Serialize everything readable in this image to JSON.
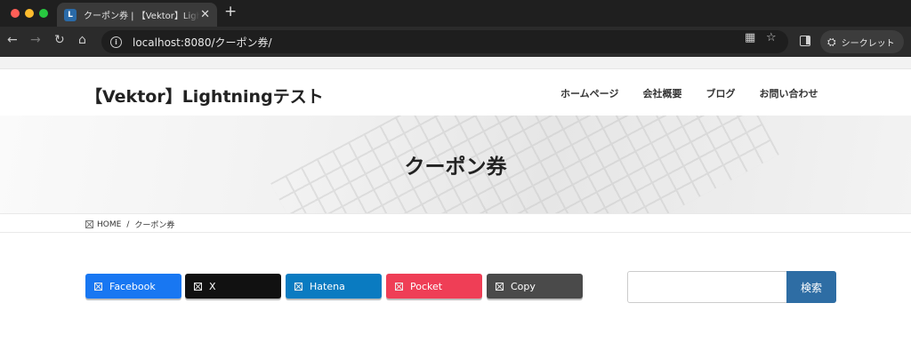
{
  "browser": {
    "tab_title": "クーポン券 | 【Vektor】Lightningテスト",
    "favicon_letter": "L",
    "tab_close": "✕",
    "new_tab": "+",
    "url": "localhost:8080/クーポン券/",
    "incognito_label": "シークレット"
  },
  "site": {
    "title": "【Vektor】Lightningテスト",
    "nav": [
      "ホームページ",
      "会社概要",
      "ブログ",
      "お問い合わせ"
    ]
  },
  "page": {
    "title": "クーポン券",
    "breadcrumb": {
      "home": "HOME",
      "separator": "/",
      "current": "クーポン券"
    }
  },
  "share_buttons": [
    {
      "label": "Facebook",
      "color": "#1877f2"
    },
    {
      "label": "X",
      "color": "#111111"
    },
    {
      "label": "Hatena",
      "color": "#0a7bc1"
    },
    {
      "label": "Pocket",
      "color": "#ef3e56"
    },
    {
      "label": "Copy",
      "color": "#4a4a4a"
    }
  ],
  "search": {
    "button_label": "検索",
    "value": ""
  },
  "colors": {
    "accent": "#2e6da4"
  }
}
